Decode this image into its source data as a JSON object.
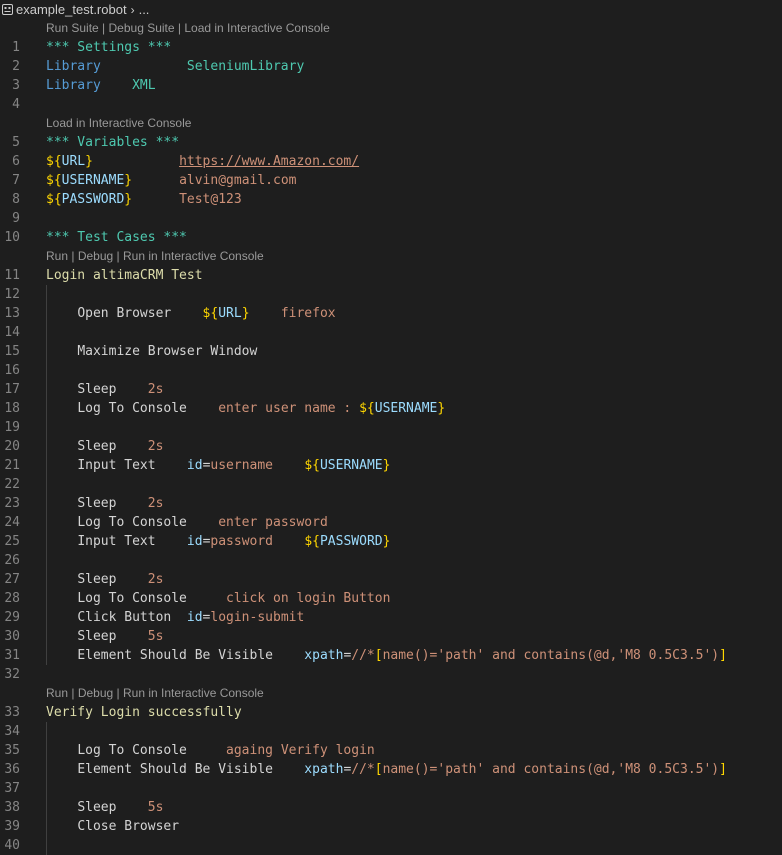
{
  "breadcrumb": {
    "filename": "example_test.robot",
    "chevron": "›",
    "ellipsis": "..."
  },
  "lens": {
    "suite": [
      "Run Suite",
      "Debug Suite",
      "Load in Interactive Console"
    ],
    "variables": [
      "Load in Interactive Console"
    ],
    "test1": [
      "Run",
      "Debug",
      "Run in Interactive Console"
    ],
    "test2": [
      "Run",
      "Debug",
      "Run in Interactive Console"
    ],
    "separator": " | "
  },
  "lines": {
    "l1": {
      "n": "1",
      "a": "*** Settings ***"
    },
    "l2": {
      "n": "2",
      "a": "Library",
      "b": "SeleniumLibrary"
    },
    "l3": {
      "n": "3",
      "a": "Library",
      "b": "XML"
    },
    "l4": {
      "n": "4"
    },
    "l5": {
      "n": "5",
      "a": "*** Variables ***"
    },
    "l6": {
      "n": "6",
      "a": "URL",
      "b": "https://www.Amazon.com/"
    },
    "l7": {
      "n": "7",
      "a": "USERNAME",
      "b": "alvin@gmail.com"
    },
    "l8": {
      "n": "8",
      "a": "PASSWORD",
      "b": "Test@123"
    },
    "l9": {
      "n": "9"
    },
    "l10": {
      "n": "10",
      "a": "*** Test Cases ***"
    },
    "l11": {
      "n": "11",
      "a": "Login altimaCRM Test"
    },
    "l12": {
      "n": "12"
    },
    "l13": {
      "n": "13",
      "a": "Open Browser",
      "b": "URL",
      "c": "firefox"
    },
    "l14": {
      "n": "14"
    },
    "l15": {
      "n": "15",
      "a": "Maximize Browser Window"
    },
    "l16": {
      "n": "16"
    },
    "l17": {
      "n": "17",
      "a": "Sleep",
      "b": "2s"
    },
    "l18": {
      "n": "18",
      "a": "Log To Console",
      "b": "enter user name : ",
      "c": "USERNAME"
    },
    "l19": {
      "n": "19"
    },
    "l20": {
      "n": "20",
      "a": "Sleep",
      "b": "2s"
    },
    "l21": {
      "n": "21",
      "a": "Input Text",
      "b": "id",
      "c": "username",
      "d": "USERNAME"
    },
    "l22": {
      "n": "22"
    },
    "l23": {
      "n": "23",
      "a": "Sleep",
      "b": "2s"
    },
    "l24": {
      "n": "24",
      "a": "Log To Console",
      "b": "enter password"
    },
    "l25": {
      "n": "25",
      "a": "Input Text",
      "b": "id",
      "c": "password",
      "d": "PASSWORD"
    },
    "l26": {
      "n": "26"
    },
    "l27": {
      "n": "27",
      "a": "Sleep",
      "b": "2s"
    },
    "l28": {
      "n": "28",
      "a": "Log To Console",
      "b": "click on login Button"
    },
    "l29": {
      "n": "29",
      "a": "Click Button",
      "b": "id",
      "c": "login-submit"
    },
    "l30": {
      "n": "30",
      "a": "Sleep",
      "b": "5s"
    },
    "l31": {
      "n": "31",
      "a": "Element Should Be Visible",
      "b": "xpath",
      "c": "//*",
      "d": "name()='path' and contains(@d,'M8 0.5C3.5')"
    },
    "l32": {
      "n": "32"
    },
    "l33": {
      "n": "33",
      "a": "Verify Login successfully"
    },
    "l34": {
      "n": "34"
    },
    "l35": {
      "n": "35",
      "a": "Log To Console",
      "b": "againg Verify login"
    },
    "l36": {
      "n": "36",
      "a": "Element Should Be Visible",
      "b": "xpath",
      "c": "//*",
      "d": "name()='path' and contains(@d,'M8 0.5C3.5')"
    },
    "l37": {
      "n": "37"
    },
    "l38": {
      "n": "38",
      "a": "Sleep",
      "b": "5s"
    },
    "l39": {
      "n": "39",
      "a": "Close Browser"
    },
    "l40": {
      "n": "40"
    }
  },
  "colors": {
    "background": "#1e1e1e",
    "section_header": "#4ec9b0",
    "keyword_setting": "#569cd6",
    "variable": "#9cdcfe",
    "variable_brace": "#ffd700",
    "string": "#ce9178",
    "test_case_name": "#dcdcaa",
    "bracket": "#da70d6"
  }
}
